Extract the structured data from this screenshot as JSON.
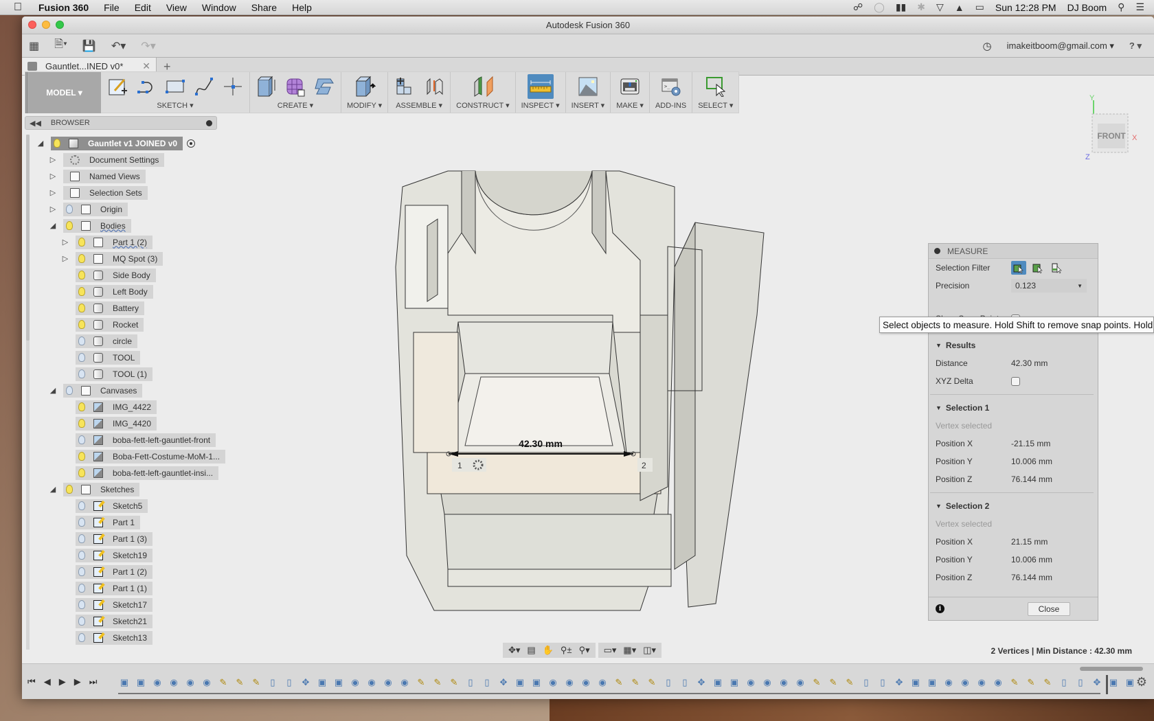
{
  "menubar": {
    "app_name": "Fusion 360",
    "items": [
      "File",
      "Edit",
      "View",
      "Window",
      "Share",
      "Help"
    ],
    "clock": "Sun 12:28 PM",
    "user": "DJ Boom",
    "status_icons": [
      "creative-cloud-icon",
      "sync-icon",
      "audio-icon",
      "bluetooth-icon",
      "wifi-icon",
      "airplay-icon",
      "battery-icon"
    ]
  },
  "window": {
    "title": "Autodesk Fusion 360",
    "account": "imakeitboom@gmail.com ▾",
    "help": "? ▾"
  },
  "tabs": [
    {
      "label": "Gauntlet...INED v0*",
      "active": true
    }
  ],
  "toolbar": {
    "workspace": "MODEL ▾",
    "groups": [
      {
        "label": "SKETCH ▾",
        "tools": [
          "create-sketch",
          "arc",
          "rectangle",
          "spline",
          "point"
        ]
      },
      {
        "label": "CREATE ▾",
        "tools": [
          "extrude",
          "create-form",
          "sweep"
        ]
      },
      {
        "label": "MODIFY ▾",
        "tools": [
          "press-pull"
        ]
      },
      {
        "label": "ASSEMBLE ▾",
        "tools": [
          "new-component",
          "joint"
        ]
      },
      {
        "label": "CONSTRUCT ▾",
        "tools": [
          "offset-plane"
        ]
      },
      {
        "label": "INSPECT ▾",
        "tools": [
          "measure"
        ],
        "active": true
      },
      {
        "label": "INSERT ▾",
        "tools": [
          "insert-canvas"
        ]
      },
      {
        "label": "MAKE ▾",
        "tools": [
          "3d-print"
        ]
      },
      {
        "label": "ADD-INS",
        "tools": [
          "scripts"
        ]
      },
      {
        "label": "SELECT ▾",
        "tools": [
          "select"
        ]
      }
    ]
  },
  "browser": {
    "title": "BROWSER",
    "root": "Gauntlet v1 JOINED v0",
    "items": [
      {
        "label": "Document Settings",
        "level": 1,
        "icon": "gear",
        "bulb": null,
        "expand": "right"
      },
      {
        "label": "Named Views",
        "level": 1,
        "icon": "folder",
        "bulb": null,
        "expand": "right"
      },
      {
        "label": "Selection Sets",
        "level": 1,
        "icon": "folder",
        "bulb": null,
        "expand": "right"
      },
      {
        "label": "Origin",
        "level": 1,
        "icon": "folder",
        "bulb": "off",
        "expand": "right"
      },
      {
        "label": "Bodies",
        "level": 1,
        "icon": "folder",
        "bulb": "on",
        "expand": "down"
      },
      {
        "label": "Part 1 (2)",
        "level": 2,
        "icon": "folder",
        "bulb": "on",
        "expand": "right"
      },
      {
        "label": "MQ Spot (3)",
        "level": 2,
        "icon": "folder",
        "bulb": "on",
        "expand": "right"
      },
      {
        "label": "Side Body",
        "level": 2,
        "icon": "body",
        "bulb": "on",
        "expand": null
      },
      {
        "label": "Left Body",
        "level": 2,
        "icon": "body",
        "bulb": "on",
        "expand": null
      },
      {
        "label": "Battery",
        "level": 2,
        "icon": "body",
        "bulb": "on",
        "expand": null
      },
      {
        "label": "Rocket",
        "level": 2,
        "icon": "body",
        "bulb": "on",
        "expand": null
      },
      {
        "label": "circle",
        "level": 2,
        "icon": "body",
        "bulb": "off",
        "expand": null
      },
      {
        "label": "TOOL",
        "level": 2,
        "icon": "body",
        "bulb": "off",
        "expand": null
      },
      {
        "label": "TOOL (1)",
        "level": 2,
        "icon": "body",
        "bulb": "off",
        "expand": null
      },
      {
        "label": "Canvases",
        "level": 1,
        "icon": "folder",
        "bulb": "off",
        "expand": "down"
      },
      {
        "label": "IMG_4422",
        "level": 2,
        "icon": "canvas",
        "bulb": "on",
        "expand": null
      },
      {
        "label": "IMG_4420",
        "level": 2,
        "icon": "canvas",
        "bulb": "on",
        "expand": null
      },
      {
        "label": "boba-fett-left-gauntlet-front",
        "level": 2,
        "icon": "canvas",
        "bulb": "off",
        "expand": null
      },
      {
        "label": "Boba-Fett-Costume-MoM-1...",
        "level": 2,
        "icon": "canvas",
        "bulb": "on",
        "expand": null
      },
      {
        "label": "boba-fett-left-gauntlet-insi...",
        "level": 2,
        "icon": "canvas",
        "bulb": "on",
        "expand": null
      },
      {
        "label": "Sketches",
        "level": 1,
        "icon": "folder",
        "bulb": "on",
        "expand": "down"
      },
      {
        "label": "Sketch5",
        "level": 2,
        "icon": "sketch",
        "bulb": "off",
        "expand": null
      },
      {
        "label": "Part 1",
        "level": 2,
        "icon": "sketch",
        "bulb": "off",
        "expand": null
      },
      {
        "label": "Part 1 (3)",
        "level": 2,
        "icon": "sketch",
        "bulb": "off",
        "expand": null
      },
      {
        "label": "Sketch19",
        "level": 2,
        "icon": "sketch",
        "bulb": "off",
        "expand": null
      },
      {
        "label": "Part 1 (2)",
        "level": 2,
        "icon": "sketch",
        "bulb": "off",
        "expand": null
      },
      {
        "label": "Part 1 (1)",
        "level": 2,
        "icon": "sketch",
        "bulb": "off",
        "expand": null
      },
      {
        "label": "Sketch17",
        "level": 2,
        "icon": "sketch",
        "bulb": "off",
        "expand": null
      },
      {
        "label": "Sketch21",
        "level": 2,
        "icon": "sketch",
        "bulb": "off",
        "expand": null
      },
      {
        "label": "Sketch13",
        "level": 2,
        "icon": "sketch",
        "bulb": "off",
        "expand": null
      }
    ]
  },
  "viewport": {
    "dimension_label": "42.30 mm",
    "point1": "1",
    "point2": "2",
    "viewcube": {
      "face": "FRONT",
      "x": "X",
      "y": "Y",
      "z": "Z"
    }
  },
  "measure": {
    "title": "MEASURE",
    "selection_filter_label": "Selection Filter",
    "precision_label": "Precision",
    "precision_value": "0.123",
    "show_snap_label": "Show Snap Points",
    "results_label": "Results",
    "distance_label": "Distance",
    "distance_value": "42.30 mm",
    "xyz_delta_label": "XYZ Delta",
    "selection1": {
      "label": "Selection 1",
      "status": "Vertex selected",
      "rows": [
        {
          "label": "Position X",
          "value": "-21.15 mm"
        },
        {
          "label": "Position Y",
          "value": "10.006 mm"
        },
        {
          "label": "Position Z",
          "value": "76.144 mm"
        }
      ]
    },
    "selection2": {
      "label": "Selection 2",
      "status": "Vertex selected",
      "rows": [
        {
          "label": "Position X",
          "value": "21.15 mm"
        },
        {
          "label": "Position Y",
          "value": "10.006 mm"
        },
        {
          "label": "Position Z",
          "value": "76.144 mm"
        }
      ]
    },
    "close_label": "Close",
    "tooltip": "Select objects to measure. Hold Shift to remove snap points. Hold Cmd"
  },
  "status": {
    "text": "2 Vertices | Min Distance : 42.30 mm"
  },
  "timeline": {
    "controls": [
      "first",
      "previous",
      "play",
      "next",
      "last"
    ],
    "feature_count": 62
  }
}
